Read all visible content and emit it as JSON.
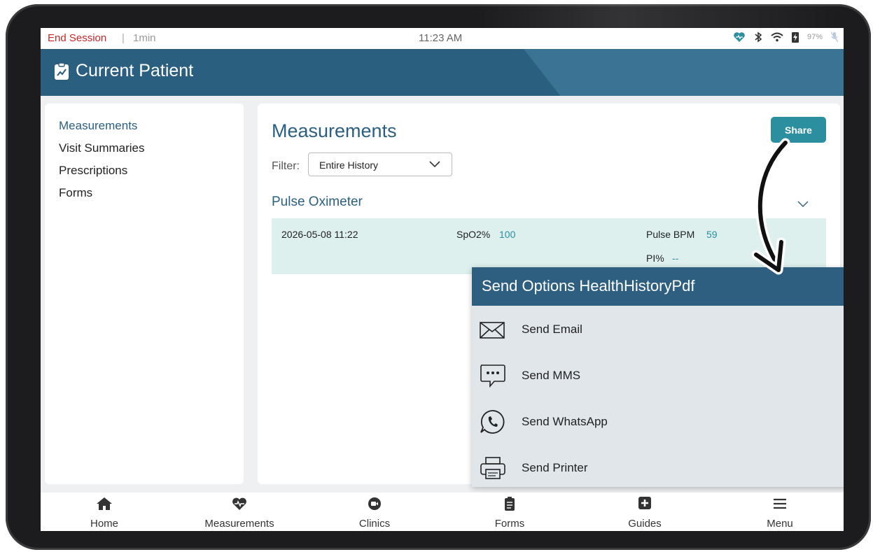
{
  "statusbar": {
    "end_session": "End Session",
    "separator": "|",
    "duration": "1min",
    "time": "11:23 AM",
    "battery": "97%"
  },
  "header": {
    "title": "Current Patient"
  },
  "sidebar": {
    "items": [
      {
        "label": "Measurements",
        "active": true
      },
      {
        "label": "Visit Summaries"
      },
      {
        "label": "Prescriptions"
      },
      {
        "label": "Forms"
      }
    ]
  },
  "main": {
    "title": "Measurements",
    "share_label": "Share",
    "filter_label": "Filter:",
    "filter_value": "Entire History",
    "section_title": "Pulse Oximeter",
    "record": {
      "date": "2026-05-08 11:22",
      "spo2_label": "SpO2%",
      "spo2_value": "100",
      "pulse_label": "Pulse BPM",
      "pulse_value": "59",
      "pi_label": "PI%",
      "pi_value": "--"
    }
  },
  "modal": {
    "title": "Send Options HealthHistoryPdf",
    "options": [
      {
        "label": "Send Email",
        "icon": "envelope-icon"
      },
      {
        "label": "Send MMS",
        "icon": "chat-bubble-icon"
      },
      {
        "label": "Send WhatsApp",
        "icon": "whatsapp-icon"
      },
      {
        "label": "Send Printer",
        "icon": "printer-icon"
      }
    ]
  },
  "bottom_nav": {
    "items": [
      {
        "label": "Home",
        "icon": "home-icon"
      },
      {
        "label": "Measurements",
        "icon": "heart-pulse-icon"
      },
      {
        "label": "Clinics",
        "icon": "video-icon"
      },
      {
        "label": "Forms",
        "icon": "clipboard-icon"
      },
      {
        "label": "Guides",
        "icon": "plus-square-icon"
      },
      {
        "label": "Menu",
        "icon": "hamburger-icon"
      }
    ]
  },
  "colors": {
    "primary": "#2b5f80",
    "accent": "#2b8fa0",
    "danger": "#c62828",
    "record_bg": "#ddf0ee"
  }
}
